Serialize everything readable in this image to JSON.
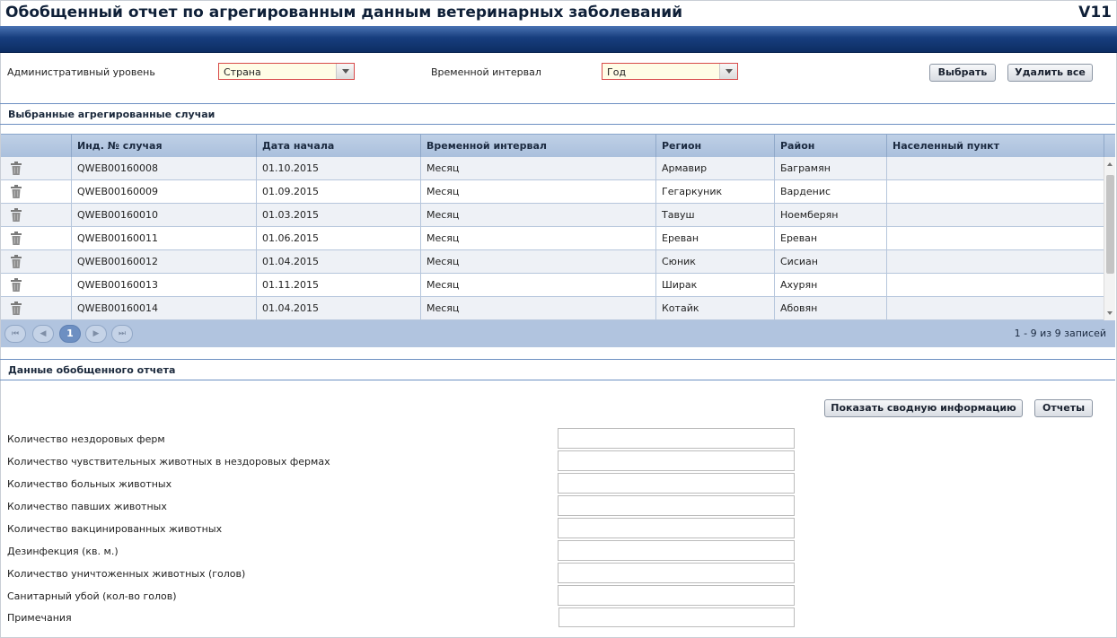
{
  "header": {
    "title": "Обобщенный отчет по агрегированным данным ветеринарных заболеваний",
    "version": "V11"
  },
  "filters": {
    "admin_level_label": "Административный уровень",
    "admin_level_value": "Страна",
    "time_interval_label": "Временной интервал",
    "time_interval_value": "Год",
    "select_button": "Выбрать",
    "delete_all_button": "Удалить все"
  },
  "cases_section": {
    "title": "Выбранные агрегированные случаи",
    "columns": [
      "Инд. № случая",
      "Дата начала",
      "Временной интервал",
      "Регион",
      "Район",
      "Населенный пункт"
    ],
    "rows": [
      {
        "id": "QWEB00160008",
        "start": "01.10.2015",
        "interval": "Месяц",
        "region": "Армавир",
        "district": "Баграмян",
        "settlement": ""
      },
      {
        "id": "QWEB00160009",
        "start": "01.09.2015",
        "interval": "Месяц",
        "region": "Гегаркуник",
        "district": "Варденис",
        "settlement": ""
      },
      {
        "id": "QWEB00160010",
        "start": "01.03.2015",
        "interval": "Месяц",
        "region": "Тавуш",
        "district": "Ноемберян",
        "settlement": ""
      },
      {
        "id": "QWEB00160011",
        "start": "01.06.2015",
        "interval": "Месяц",
        "region": "Ереван",
        "district": "Ереван",
        "settlement": ""
      },
      {
        "id": "QWEB00160012",
        "start": "01.04.2015",
        "interval": "Месяц",
        "region": "Сюник",
        "district": "Сисиан",
        "settlement": ""
      },
      {
        "id": "QWEB00160013",
        "start": "01.11.2015",
        "interval": "Месяц",
        "region": "Ширак",
        "district": "Ахурян",
        "settlement": ""
      },
      {
        "id": "QWEB00160014",
        "start": "01.04.2015",
        "interval": "Месяц",
        "region": "Котайк",
        "district": "Абовян",
        "settlement": ""
      }
    ],
    "pager": {
      "current_page": "1",
      "info": "1 - 9 из 9 записей"
    }
  },
  "report_section": {
    "title": "Данные обобщенного отчета",
    "summary_button": "Показать сводную информацию",
    "reports_button": "Отчеты",
    "fields": [
      {
        "label": "Количество нездоровых ферм",
        "value": ""
      },
      {
        "label": "Количество чувствительных животных в нездоровых фермах",
        "value": ""
      },
      {
        "label": "Количество больных животных",
        "value": ""
      },
      {
        "label": "Количество павших животных",
        "value": ""
      },
      {
        "label": "Количество вакцинированных животных",
        "value": ""
      },
      {
        "label": "Дезинфекция (кв. м.)",
        "value": ""
      },
      {
        "label": "Количество уничтоженных животных (голов)",
        "value": ""
      },
      {
        "label": "Санитарный убой (кол-во голов)",
        "value": ""
      },
      {
        "label": "Примечания",
        "value": ""
      }
    ]
  }
}
